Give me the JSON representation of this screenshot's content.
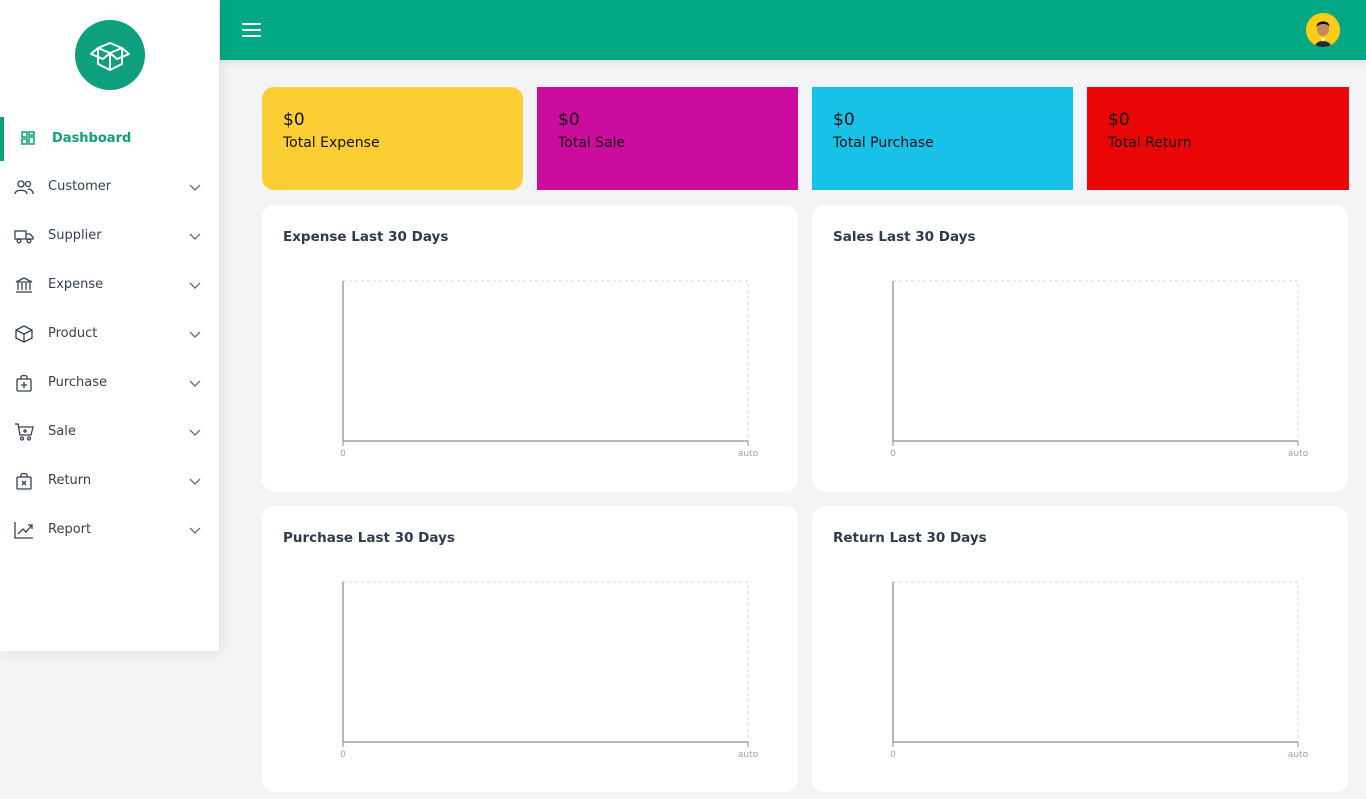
{
  "sidebar": {
    "items": [
      {
        "label": "Dashboard",
        "icon": "dashboard-grid-icon",
        "active": true
      },
      {
        "label": "Customer",
        "icon": "users-icon"
      },
      {
        "label": "Supplier",
        "icon": "truck-icon"
      },
      {
        "label": "Expense",
        "icon": "bank-icon"
      },
      {
        "label": "Product",
        "icon": "box-icon"
      },
      {
        "label": "Purchase",
        "icon": "bag-plus-icon"
      },
      {
        "label": "Sale",
        "icon": "cart-icon"
      },
      {
        "label": "Return",
        "icon": "bag-x-icon"
      },
      {
        "label": "Report",
        "icon": "chart-line-icon"
      }
    ]
  },
  "stats": [
    {
      "amount": "$0",
      "label": "Total Expense",
      "color": "#fbcf33"
    },
    {
      "amount": "$0",
      "label": "Total Sale",
      "color": "#cb0c9f"
    },
    {
      "amount": "$0",
      "label": "Total Purchase",
      "color": "#17c1e8"
    },
    {
      "amount": "$0",
      "label": "Total Return",
      "color": "#ea0606"
    }
  ],
  "charts": [
    {
      "title": "Expense Last 30 Days",
      "x_start": "0",
      "x_end": "auto"
    },
    {
      "title": "Sales Last 30 Days",
      "x_start": "0",
      "x_end": "auto"
    },
    {
      "title": "Purchase Last 30 Days",
      "x_start": "0",
      "x_end": "auto"
    },
    {
      "title": "Return Last 30 Days",
      "x_start": "0",
      "x_end": "auto"
    }
  ],
  "chart_data": [
    {
      "type": "line",
      "title": "Expense Last 30 Days",
      "series": [],
      "x_tick_labels": [
        "0",
        "auto"
      ],
      "grid": true
    },
    {
      "type": "line",
      "title": "Sales Last 30 Days",
      "series": [],
      "x_tick_labels": [
        "0",
        "auto"
      ],
      "grid": true
    },
    {
      "type": "line",
      "title": "Purchase Last 30 Days",
      "series": [],
      "x_tick_labels": [
        "0",
        "auto"
      ],
      "grid": true
    },
    {
      "type": "line",
      "title": "Return Last 30 Days",
      "series": [],
      "x_tick_labels": [
        "0",
        "auto"
      ],
      "grid": true
    }
  ],
  "colors": {
    "brand": "#02a883",
    "accent": "#0e9f7e"
  }
}
